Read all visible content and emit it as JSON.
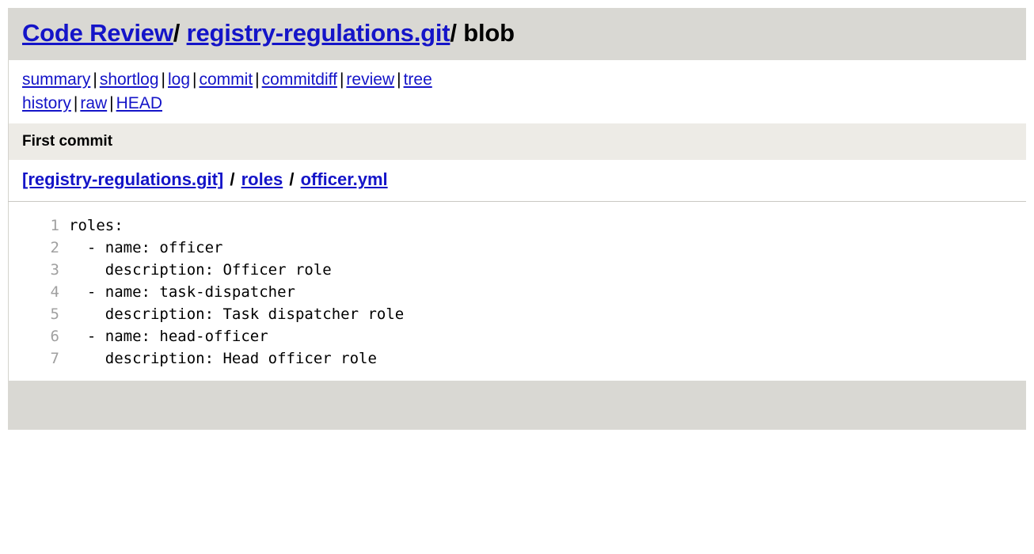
{
  "header": {
    "project_link": "Code Review",
    "repo_link": "registry-regulations.git",
    "separator": "/",
    "view": "blob"
  },
  "nav": {
    "separator": "|",
    "line1": [
      {
        "label": "summary"
      },
      {
        "label": "shortlog"
      },
      {
        "label": "log"
      },
      {
        "label": "commit"
      },
      {
        "label": "commitdiff"
      },
      {
        "label": "review"
      },
      {
        "label": "tree"
      }
    ],
    "line2": [
      {
        "label": "history"
      },
      {
        "label": "raw"
      },
      {
        "label": "HEAD"
      }
    ]
  },
  "commit": {
    "title": "First commit"
  },
  "path": {
    "separator": "/",
    "crumbs": [
      {
        "label": "[registry-regulations.git]"
      },
      {
        "label": "roles"
      },
      {
        "label": "officer.yml"
      }
    ]
  },
  "blob": {
    "filename": "officer.yml",
    "lines": [
      {
        "num": "1",
        "text": "roles:"
      },
      {
        "num": "2",
        "text": "  - name: officer"
      },
      {
        "num": "3",
        "text": "    description: Officer role"
      },
      {
        "num": "4",
        "text": "  - name: task-dispatcher"
      },
      {
        "num": "5",
        "text": "    description: Task dispatcher role"
      },
      {
        "num": "6",
        "text": "  - name: head-officer"
      },
      {
        "num": "7",
        "text": "    description: Head officer role"
      }
    ]
  },
  "colors": {
    "link": "#1414c8",
    "header_band": "#d9d8d3",
    "commit_band": "#edebe6",
    "footer_band": "#d9d8d3",
    "lineno": "#a0a0a0",
    "rule": "#c9c8c3"
  }
}
